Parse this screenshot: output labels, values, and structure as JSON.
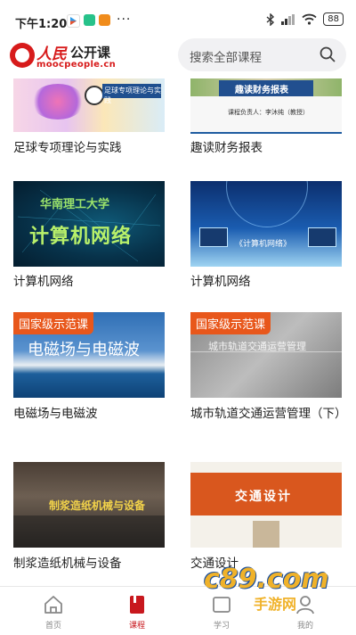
{
  "status_bar": {
    "time": "下午1:20",
    "dots": "···",
    "battery": "88"
  },
  "header": {
    "logo_script": "人民",
    "logo_name": "公开课",
    "logo_domain": "moocpeople.cn",
    "search_placeholder": "搜索全部课程"
  },
  "courses": [
    {
      "title": "足球专项理论与实践",
      "thumb_caption": "足球专项理论与实践"
    },
    {
      "title": "趣读财务报表",
      "thumb_caption": "趣读财务报表",
      "thumb_sub": "课程负责人：李沐纯（教授）"
    },
    {
      "title": "计算机网络",
      "thumb_caption": "华南理工大学",
      "thumb_main": "计算机网络"
    },
    {
      "title": "计算机网络",
      "thumb_caption": "《计算机网络》"
    },
    {
      "title": "电磁场与电磁波",
      "badge": "国家级示范课",
      "thumb_caption": "电磁场与电磁波"
    },
    {
      "title": "城市轨道交通运营管理（下）",
      "badge": "国家级示范课",
      "thumb_caption": "城市轨道交通运营管理"
    },
    {
      "title": "制浆造纸机械与设备",
      "thumb_caption": "制浆造纸机械与设备"
    },
    {
      "title": "交通设计",
      "thumb_caption": "交通设计"
    }
  ],
  "tabs": [
    {
      "label": "首页"
    },
    {
      "label": "课程"
    },
    {
      "label": "学习"
    },
    {
      "label": "我的"
    }
  ],
  "watermark": {
    "text": "c89.com",
    "sub": "手游网"
  }
}
